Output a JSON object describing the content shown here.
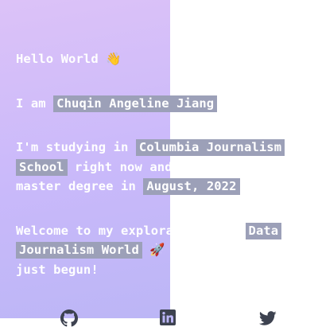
{
  "intro": {
    "greeting": "Hello World",
    "greeting_emoji": "👋",
    "iam_prefix": "I am",
    "name": "Chuqin Angeline Jiang",
    "study_prefix": "I'm studying in",
    "school_line1": "Columbia Journalism",
    "school_line2": "School",
    "study_middle": "right now and",
    "study_line3_prefix": "master degree in",
    "graduation": "August, 2022",
    "welcome_prefix": "Welcome to my explora",
    "world_part1": "Data",
    "world_part2": "Journalism World",
    "rocket_emoji": "🚀",
    "ending": "just begun!"
  },
  "social": {
    "icons": [
      "github-icon",
      "linkedin-icon",
      "twitter-icon"
    ]
  },
  "colors": {
    "gradient_start": "#dcc2f8",
    "gradient_end": "#bcb6f6",
    "highlight": "#9ca0b8",
    "text": "#ffffff",
    "icon": "#3d4250"
  }
}
